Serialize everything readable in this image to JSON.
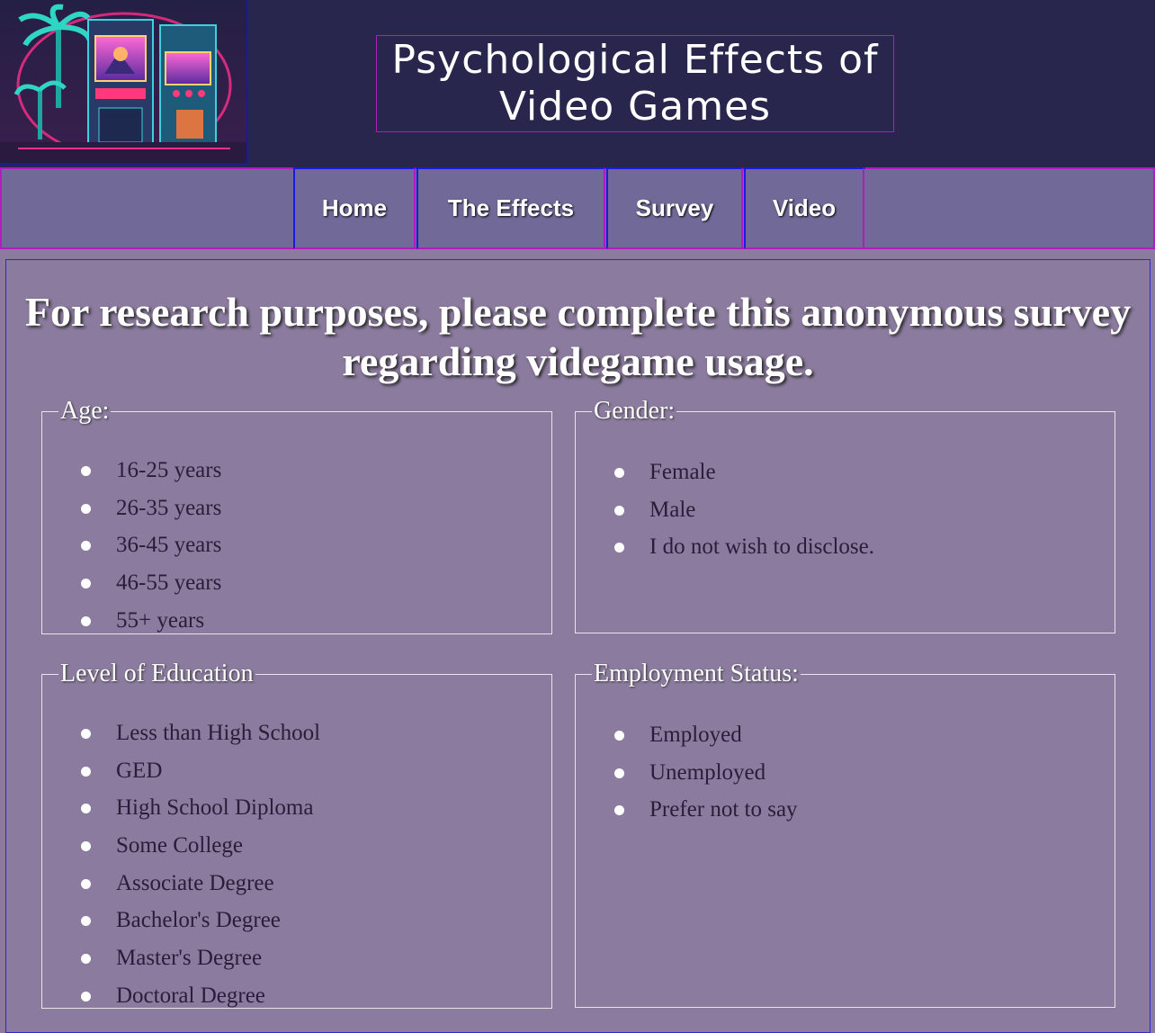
{
  "header": {
    "logo_alt": "Retro arcade cabinets with palm trees in neon synthwave style",
    "title": "Psychological Effects of Video Games"
  },
  "nav": {
    "items": [
      {
        "label": "Home"
      },
      {
        "label": "The Effects"
      },
      {
        "label": "Survey"
      },
      {
        "label": "Video"
      }
    ]
  },
  "main": {
    "heading": "For research purposes, please complete this anonymous survey regarding videgame usage.",
    "age": {
      "legend": "Age:",
      "options": [
        "16-25 years",
        "26-35 years",
        "36-45 years",
        "46-55 years",
        "55+ years"
      ]
    },
    "gender": {
      "legend": "Gender:",
      "options": [
        "Female",
        "Male",
        "I do not wish to disclose."
      ]
    },
    "education": {
      "legend": "Level of Education",
      "options": [
        "Less than High School",
        "GED",
        "High School Diploma",
        "Some College",
        "Associate Degree",
        "Bachelor's Degree",
        "Master's Degree",
        "Doctoral Degree"
      ]
    },
    "employment": {
      "legend": "Employment Status:",
      "options": [
        "Employed",
        "Unemployed",
        "Prefer not to say"
      ]
    }
  }
}
